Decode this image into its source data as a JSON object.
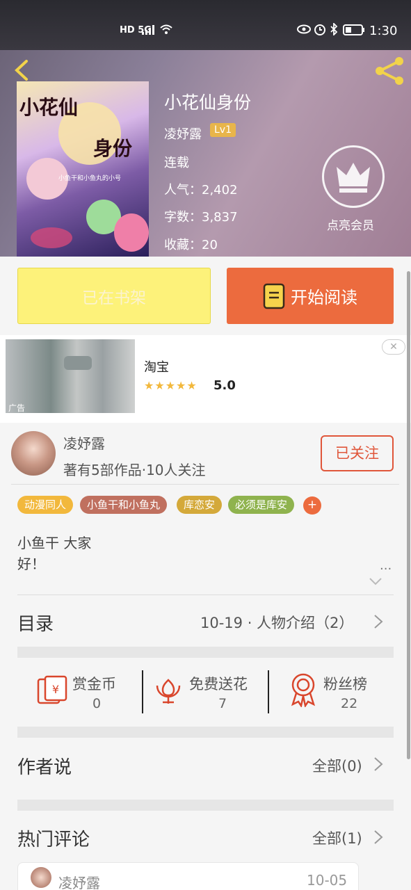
{
  "status_bar": {
    "network": "HD 5G",
    "time": "1:30"
  },
  "book": {
    "title": "小花仙身份",
    "author": "凌妤露",
    "level": "Lv1",
    "status": "连载",
    "popularity": "人气：2,402",
    "word_count": "字数：3,837",
    "favorites": "收藏：20",
    "cover_title_line1": "小花仙",
    "cover_title_line2": "身份",
    "cover_subtitle": "小鱼干和小鱼丸的小号"
  },
  "vip": {
    "label": "点亮会员"
  },
  "actions": {
    "shelf_label": "已在书架",
    "read_label": "开始阅读"
  },
  "ad": {
    "title": "淘宝",
    "rating": "5.0",
    "stars": "★★★★★",
    "label": "广告",
    "close": "✕"
  },
  "author_card": {
    "name": "凌妤露",
    "meta": "著有5部作品·10人关注",
    "follow_label": "已关注"
  },
  "tags": [
    {
      "label": "动漫同人",
      "color": "#f2b83c"
    },
    {
      "label": "小鱼干和小鱼丸",
      "color": "#c0705f"
    },
    {
      "label": "库恋安",
      "color": "#d4a93a"
    },
    {
      "label": "必须是库安",
      "color": "#8fb34e"
    }
  ],
  "tag_add": "+",
  "description": {
    "line1": "小鱼干 大家",
    "line2": "好！",
    "more": "..."
  },
  "toc": {
    "title": "目录",
    "latest": "10-19 · 人物介绍（2）"
  },
  "stats": [
    {
      "label": "赏金币",
      "value": "0",
      "icon": "coin-envelope-icon"
    },
    {
      "label": "免费送花",
      "value": "7",
      "icon": "flower-icon"
    },
    {
      "label": "粉丝榜",
      "value": "22",
      "icon": "medal-icon"
    }
  ],
  "author_says": {
    "title": "作者说",
    "all": "全部(0)"
  },
  "hot_comments": {
    "title": "热门评论",
    "all": "全部(1)"
  },
  "comment": {
    "name": "凌妤露",
    "date": "10-05"
  },
  "colors": {
    "accent": "#ec6b3e",
    "follow": "#e0563a",
    "shelf_bg": "#fdf27a",
    "stat_icon": "#d9462c"
  }
}
